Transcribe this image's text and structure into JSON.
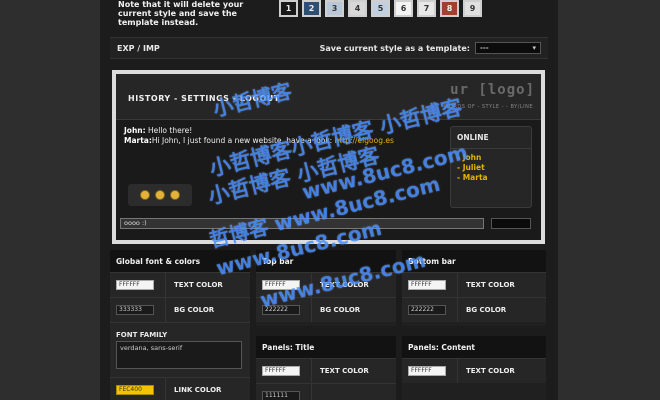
{
  "note": "Note that it will delete your current style and save the template instead.",
  "swatches": [
    "1",
    "2",
    "3",
    "4",
    "5",
    "6",
    "7",
    "8",
    "9"
  ],
  "swatch_colors": [
    "#1a1a1a",
    "#2f4f72",
    "#b8c8d8",
    "#d8d8d8",
    "#c0d0e0",
    "#f4f4f4",
    "#e8e8e8",
    "#a04030",
    "#e0e0e0"
  ],
  "exp_bar": {
    "left_label": "EXP / IMP",
    "template_label": "Save current style as a template:",
    "template_value": "---"
  },
  "preview": {
    "nav": "HISTORY - SETTINGS - LOGOUT",
    "logo": "ur [logo]",
    "logo_sub": "WORDS OF - STYLE - - BY/LINE",
    "messages": [
      {
        "name": "John:",
        "text": " Hello there!"
      },
      {
        "name": "Marta:",
        "text": "Hi John, I just found a new website, have a look: ",
        "link": "http://elgoog.es"
      }
    ],
    "online": {
      "title": "ONLINE",
      "users": [
        "- John",
        "- Juliet",
        "- Marta"
      ]
    },
    "input_value": "oooo :)"
  },
  "panels": {
    "global": {
      "title": "Global font & colors",
      "text_color_value": "FFFFFF",
      "text_color_label": "TEXT COLOR",
      "bg_color_value": "333333",
      "bg_color_label": "BG COLOR",
      "font_family_label": "FONT FAMILY",
      "font_family_value": "verdana, sans-serif",
      "link_color_value": "FEC400",
      "link_color_label": "LINK COLOR"
    },
    "top_bar": {
      "title": "Top bar",
      "text_color_value": "FFFFFF",
      "text_color_label": "TEXT COLOR",
      "bg_color_value": "222222",
      "bg_color_label": "BG COLOR"
    },
    "bottom_bar": {
      "title": "Bottom bar",
      "text_color_value": "FFFFFF",
      "text_color_label": "TEXT COLOR",
      "bg_color_value": "222222",
      "bg_color_label": "BG COLOR"
    },
    "panels_title": {
      "title": "Panels: Title",
      "text_color_value": "FFFFFF",
      "text_color_label": "TEXT COLOR",
      "bg_color_value": "111111"
    },
    "panels_content": {
      "title": "Panels: Content",
      "text_color_value": "FFFFFF",
      "text_color_label": "TEXT COLOR"
    }
  },
  "watermark": {
    "line1": "小哲博客",
    "line2": "小哲博客小哲博客 小哲博客",
    "line3": "小哲博客 小哲博客",
    "line4": "www.8uc8.com",
    "line5": "哲博客 www.8uc8.com",
    "line6": "www.8uc8.com",
    "line7": "www.8uc8.com"
  }
}
